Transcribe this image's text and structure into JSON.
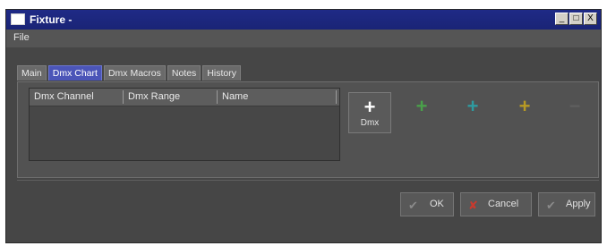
{
  "window": {
    "title": "Fixture -",
    "minimize": "_",
    "maximize": "□",
    "close": "X"
  },
  "menu": {
    "file": "File"
  },
  "tabs": [
    "Main",
    "Dmx Chart",
    "Dmx Macros",
    "Notes",
    "History"
  ],
  "active_tab": "Dmx Chart",
  "grid": {
    "columns": [
      "Dmx Channel",
      "Dmx Range",
      "Name"
    ]
  },
  "toolbar": [
    {
      "label": "Dmx",
      "icon": "plus-icon",
      "color": "#ffffff",
      "enabled": true
    },
    {
      "label": "",
      "icon": "plus-icon",
      "color": "#49a04a",
      "enabled": false
    },
    {
      "label": "",
      "icon": "plus-icon",
      "color": "#2e9ba0",
      "enabled": false
    },
    {
      "label": "",
      "icon": "plus-icon",
      "color": "#b89a24",
      "enabled": false
    },
    {
      "label": "",
      "icon": "minus-icon",
      "color": "#5e5e5e",
      "enabled": false
    }
  ],
  "buttons": {
    "ok": "OK",
    "cancel": "Cancel",
    "apply": "Apply"
  },
  "colors": {
    "accent_tab": "#4b55b8",
    "titlebar": "#1f2a86",
    "cancel_icon": "#c83a2e"
  }
}
